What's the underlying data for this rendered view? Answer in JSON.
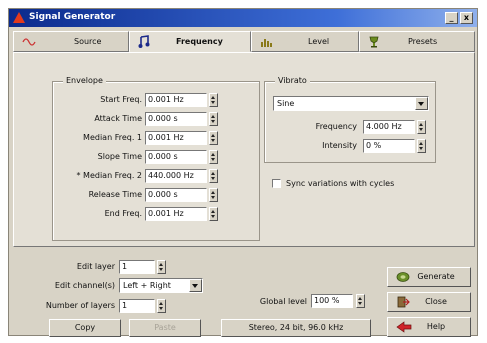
{
  "window": {
    "title": "Signal Generator",
    "minimize": "_",
    "close": "x"
  },
  "tabs": [
    {
      "label": "Source",
      "icon": "sine-wave-icon"
    },
    {
      "label": "Frequency",
      "icon": "music-note-icon",
      "active": true
    },
    {
      "label": "Level",
      "icon": "level-bars-icon"
    },
    {
      "label": "Presets",
      "icon": "presets-icon"
    }
  ],
  "envelope": {
    "title": "Envelope",
    "rows": [
      {
        "label": "Start Freq.",
        "value": "0.001 Hz"
      },
      {
        "label": "Attack Time",
        "value": "0.000 s"
      },
      {
        "label": "Median Freq. 1",
        "value": "0.001 Hz"
      },
      {
        "label": "Slope Time",
        "value": "0.000 s"
      },
      {
        "label": "* Median Freq. 2",
        "value": "440.000 Hz"
      },
      {
        "label": "Release Time",
        "value": "0.000 s"
      },
      {
        "label": "End Freq.",
        "value": "0.001 Hz"
      }
    ]
  },
  "vibrato": {
    "title": "Vibrato",
    "waveform": "Sine",
    "frequency_label": "Frequency",
    "frequency_value": "4.000 Hz",
    "intensity_label": "Intensity",
    "intensity_value": "0 %"
  },
  "sync": {
    "label": "Sync variations with cycles",
    "checked": false
  },
  "layers": {
    "edit_layer_label": "Edit layer",
    "edit_layer_value": "1",
    "edit_channels_label": "Edit channel(s)",
    "edit_channels_value": "Left + Right",
    "num_layers_label": "Number of layers",
    "num_layers_value": "1",
    "copy_label": "Copy",
    "paste_label": "Paste"
  },
  "global": {
    "level_label": "Global level",
    "level_value": "100 %",
    "format_label": "Stereo, 24 bit, 96.0 kHz"
  },
  "actions": {
    "generate": "Generate",
    "close": "Close",
    "help": "Help"
  },
  "colors": {
    "title_bar": "#0b2a8c",
    "face": "#d8d3c6",
    "panel": "#e4e0d6",
    "generate_icon": "#6a8f2a",
    "help_icon": "#d0242a"
  }
}
